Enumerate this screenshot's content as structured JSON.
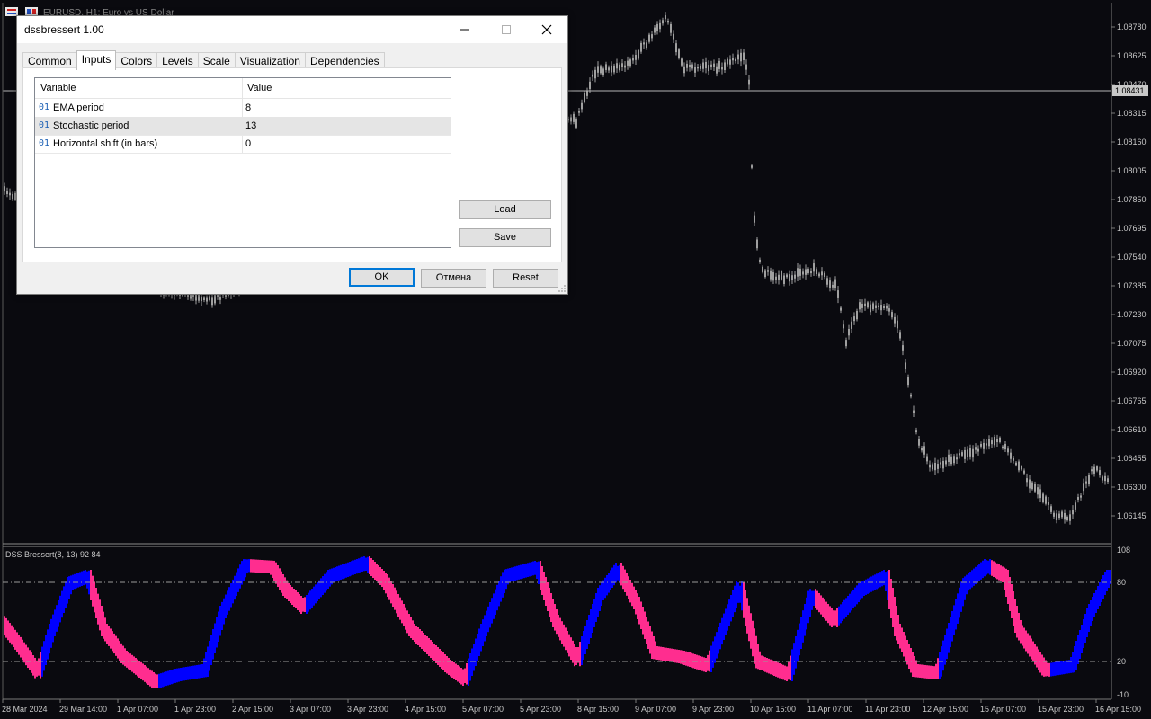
{
  "chart": {
    "title_symbol": "EURUSD, H1: Euro vs US Dollar",
    "price_ticks": [
      "1.08780",
      "1.08625",
      "1.08470",
      "1.08315",
      "1.08160",
      "1.08005",
      "1.07850",
      "1.07695",
      "1.07540",
      "1.07385",
      "1.07230",
      "1.07075",
      "1.06920",
      "1.06765",
      "1.06610",
      "1.06455",
      "1.06300",
      "1.06145"
    ],
    "current_price": "1.08431",
    "candle_color": "#a0a0a0",
    "background": "#0a0a0f"
  },
  "indicator": {
    "label": "DSS Bressert(8, 13) 92 84",
    "levels": [
      "108",
      "80",
      "20",
      "-10"
    ],
    "up_color": "#0000ff",
    "down_color": "#ff2d8f"
  },
  "time_axis": [
    "28 Mar 2024",
    "29 Mar 14:00",
    "1 Apr 07:00",
    "1 Apr 23:00",
    "2 Apr 15:00",
    "3 Apr 07:00",
    "3 Apr 23:00",
    "4 Apr 15:00",
    "5 Apr 07:00",
    "5 Apr 23:00",
    "8 Apr 15:00",
    "9 Apr 07:00",
    "9 Apr 23:00",
    "10 Apr 15:00",
    "11 Apr 07:00",
    "11 Apr 23:00",
    "12 Apr 15:00",
    "15 Apr 07:00",
    "15 Apr 23:00",
    "16 Apr 15:00"
  ],
  "dialog": {
    "title": "dssbressert 1.00",
    "tabs": [
      "Common",
      "Inputs",
      "Colors",
      "Levels",
      "Scale",
      "Visualization",
      "Dependencies"
    ],
    "active_tab": "Inputs",
    "columns": {
      "variable": "Variable",
      "value": "Value"
    },
    "params": [
      {
        "icon": "01",
        "name": "EMA period",
        "value": "8"
      },
      {
        "icon": "01",
        "name": "Stochastic period",
        "value": "13"
      },
      {
        "icon": "01",
        "name": "Horizontal shift (in bars)",
        "value": "0"
      }
    ],
    "load_label": "Load",
    "save_label": "Save",
    "ok_label": "OK",
    "cancel_label": "Отмена",
    "reset_label": "Reset"
  }
}
